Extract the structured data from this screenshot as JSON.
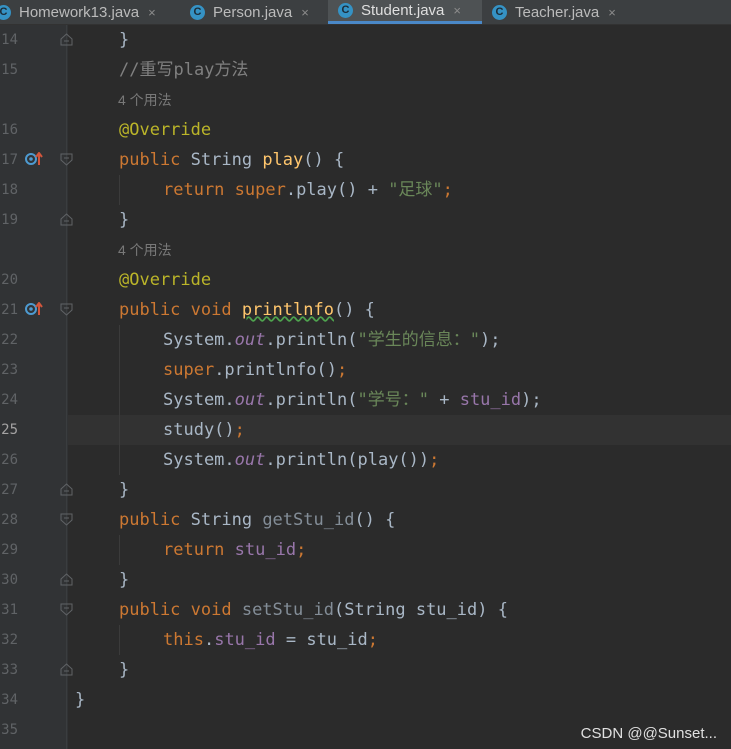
{
  "tabs": [
    {
      "name": "Homework13.java",
      "active": false
    },
    {
      "name": "Person.java",
      "active": false
    },
    {
      "name": "Student.java",
      "active": true
    },
    {
      "name": "Teacher.java",
      "active": false
    }
  ],
  "tab_icon_letter": "C",
  "close_glyph": "×",
  "line_numbers": [
    "14",
    "15",
    "",
    "16",
    "17",
    "18",
    "19",
    "",
    "20",
    "21",
    "22",
    "23",
    "24",
    "25",
    "26",
    "27",
    "28",
    "29",
    "30",
    "31",
    "32",
    "33",
    "34",
    "35"
  ],
  "current_line": "25",
  "code": {
    "l14": {
      "a": "}"
    },
    "l15": {
      "a": "//重写play方法"
    },
    "hint1": "4 个用法",
    "l16": {
      "a": "@Override"
    },
    "l17": {
      "a": "public ",
      "b": "String ",
      "c": "play",
      "d": "() {"
    },
    "l18": {
      "a": "return super",
      "b": ".play() + ",
      "c": "\"足球\"",
      "d": ";"
    },
    "l19": {
      "a": "}"
    },
    "hint2": "4 个用法",
    "l20": {
      "a": "@Override"
    },
    "l21": {
      "a": "public void ",
      "b": "printlnfo",
      "c": "() {"
    },
    "l22": {
      "a": "System.",
      "b": "out",
      "c": ".println(",
      "d": "\"学生的信息：\"",
      "e": ");"
    },
    "l23": {
      "a": "super",
      ".b": "",
      "b": ".printlnfo()",
      "c": ";"
    },
    "l24": {
      "a": "System.",
      "b": "out",
      "c": ".println(",
      "d": "\"学号：\"",
      "e": " + ",
      "f": "stu_id",
      "g": ");"
    },
    "l25": {
      "a": "study()",
      "b": ";"
    },
    "l26": {
      "a": "System.",
      "b": "out",
      "c": ".println(play())",
      "d": ";"
    },
    "l27": {
      "a": "}"
    },
    "l28": {
      "a": "public ",
      "b": "String ",
      "c": "getStu_id",
      "d": "() {"
    },
    "l29": {
      "a": "return ",
      "b": "stu_id",
      "c": ";"
    },
    "l30": {
      "a": "}"
    },
    "l31": {
      "a": "public void ",
      "b": "setStu_id",
      "c": "(String stu_id) {"
    },
    "l32": {
      "a": "this",
      "b": ".",
      "c": "stu_id",
      "d": " = stu_id",
      "e": ";"
    },
    "l33": {
      "a": "}"
    },
    "l34": {
      "a": "}"
    }
  },
  "watermark": "CSDN @@Sunset...",
  "colors": {
    "background": "#2b2b2b",
    "keyword": "#cc7832",
    "annotation": "#bbb529",
    "string": "#6a8759",
    "method": "#ffc66d",
    "field": "#9876aa",
    "comment": "#808080"
  }
}
